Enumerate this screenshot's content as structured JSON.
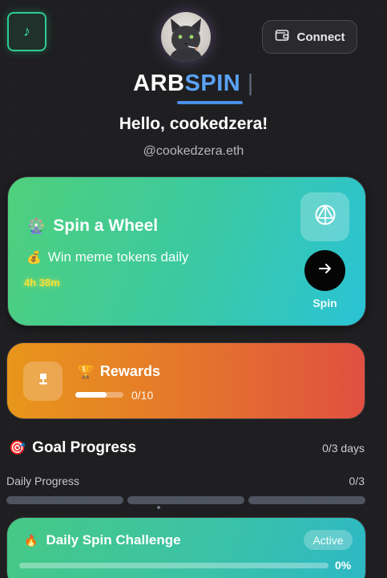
{
  "colors": {
    "music_accent": "#2ecc8f",
    "logo_spin": "#5aa2f5",
    "spin_card_gradient": [
      "#4fd07b",
      "#2ac3d6"
    ],
    "rewards_gradient": [
      "#e8961b",
      "#e05040"
    ],
    "timer": "#f3e03a"
  },
  "header": {
    "music_icon": "music-note-icon",
    "music_glyph": "♪",
    "avatar_icon": "cat-avatar",
    "connect_label": "Connect",
    "connect_icon": "wallet-icon"
  },
  "brand": {
    "part1": "ARB",
    "part2": "SPIN",
    "cursor": "|"
  },
  "greeting": {
    "hello": "Hello, cookedzera!",
    "handle": "@cookedzera.eth"
  },
  "spin_card": {
    "emoji": "🎡",
    "title": "Spin a Wheel",
    "sub_emoji": "💰",
    "subtitle": "Win meme tokens daily",
    "timer": "4h 38m",
    "wheel_icon": "wheel-icon",
    "arrow_icon": "arrow-right-icon",
    "spin_label": "Spin"
  },
  "rewards": {
    "icon": "trophy-stand-icon",
    "emoji": "🏆",
    "title": "Rewards",
    "progress": 0.65,
    "count": "0/10"
  },
  "goal": {
    "emoji": "🎯",
    "title": "Goal Progress",
    "days": "0/3 days",
    "daily_label": "Daily Progress",
    "daily_count": "0/3",
    "segments": 3
  },
  "challenge": {
    "emoji": "🔥",
    "title": "Daily Spin Challenge",
    "badge": "Active",
    "progress": 0,
    "percent": "0%"
  }
}
